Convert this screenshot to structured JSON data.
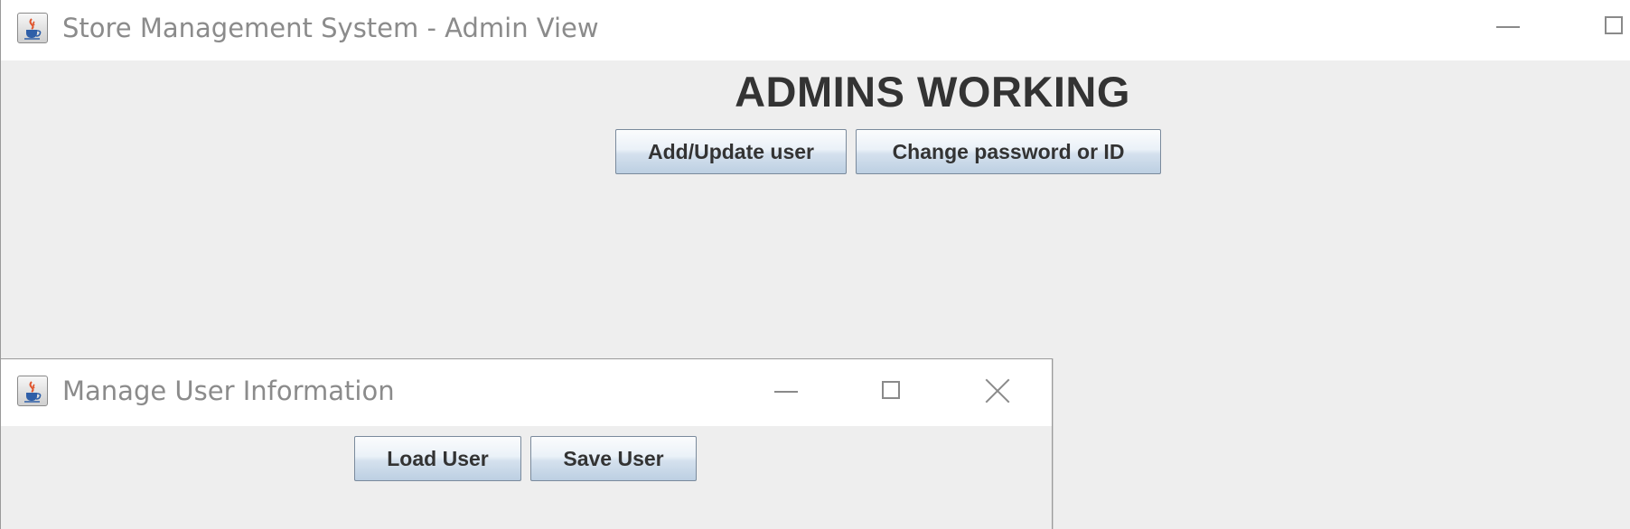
{
  "main_window": {
    "title": "Store Management System - Admin View",
    "heading": "ADMINS WORKING",
    "buttons": {
      "add_update": "Add/Update user",
      "change_password": "Change password or ID"
    },
    "icons": {
      "app": "java-cup-icon",
      "minimize": "minimize-icon",
      "maximize": "maximize-icon"
    }
  },
  "dialog": {
    "title": "Manage User Information",
    "buttons": {
      "load": "Load User",
      "save": "Save User"
    },
    "icons": {
      "app": "java-cup-icon",
      "minimize": "minimize-icon",
      "maximize": "maximize-icon",
      "close": "close-icon"
    }
  },
  "colors": {
    "window_background": "#eeeeee",
    "titlebar": "#ffffff",
    "title_text": "#8b8b8b",
    "heading_text": "#333333",
    "button_gradient_top": "#fbfcfd",
    "button_gradient_bottom": "#bccfe2"
  }
}
